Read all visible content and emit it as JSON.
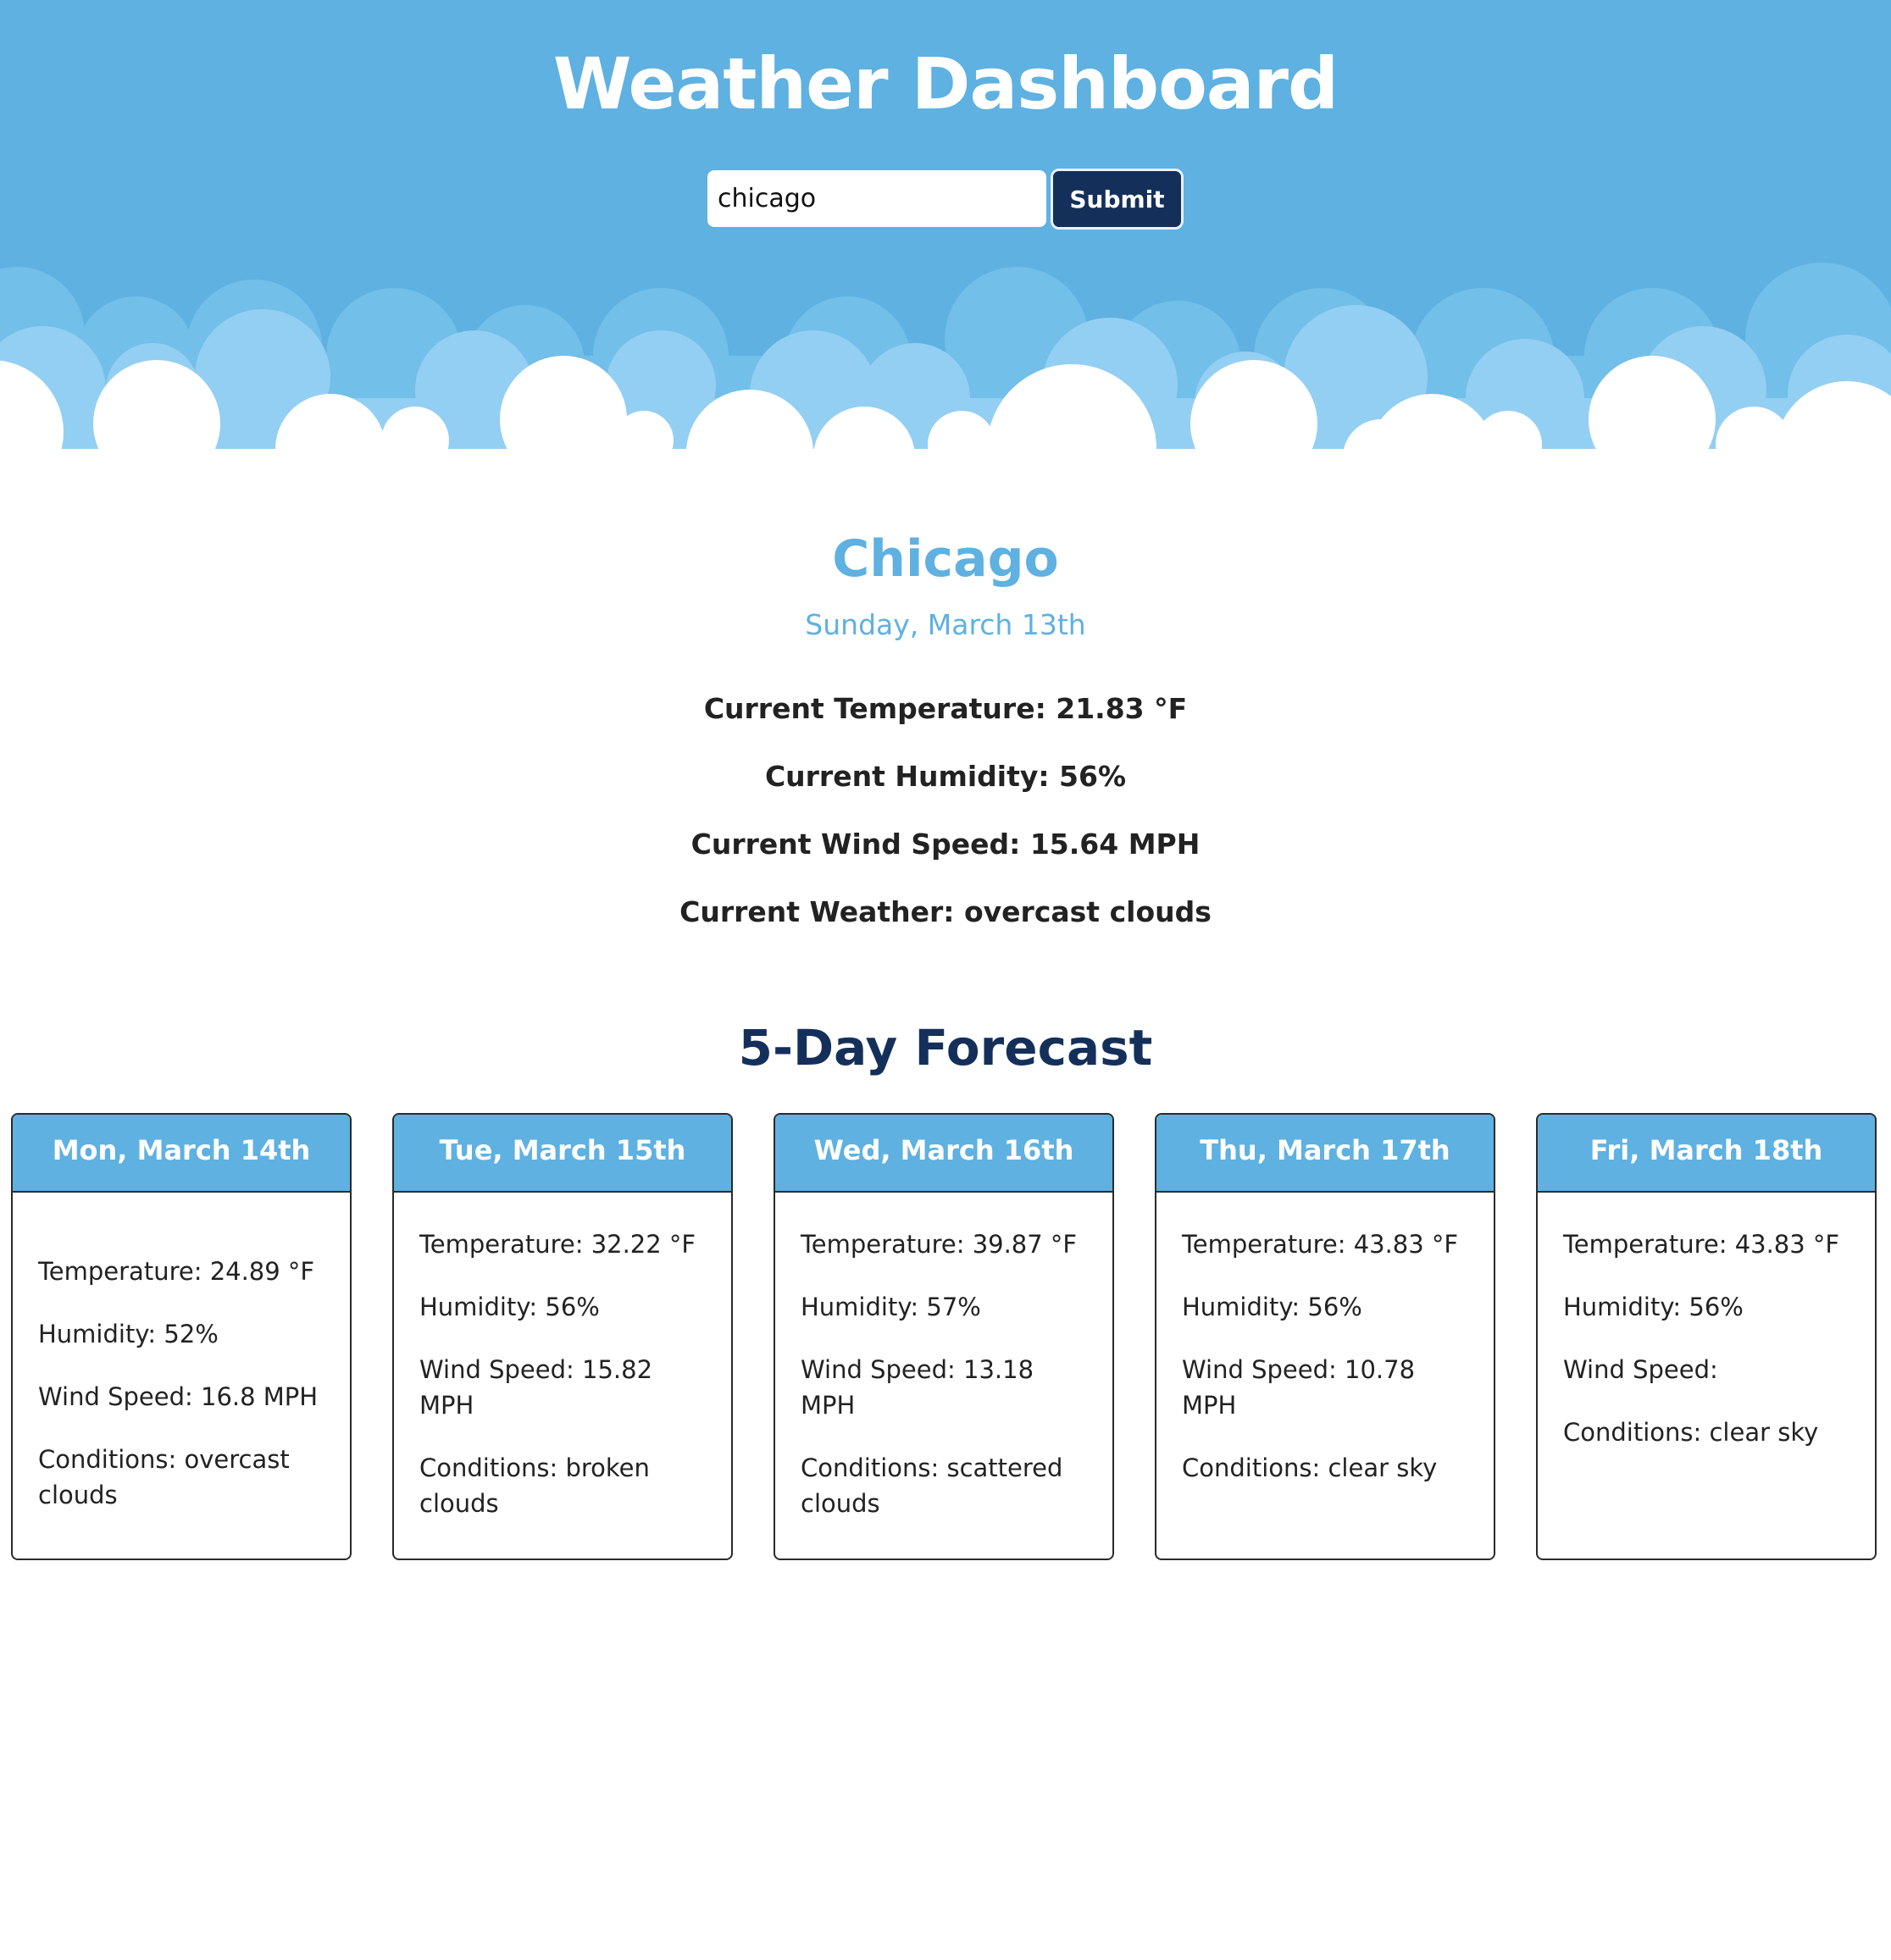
{
  "header": {
    "title": "Weather Dashboard",
    "search_value": "chicago",
    "submit_label": "Submit"
  },
  "current": {
    "city": "Chicago",
    "date": "Sunday, March 13th",
    "temperature": "Current Temperature: 21.83 °F",
    "humidity": "Current Humidity: 56%",
    "wind": "Current Wind Speed: 15.64 MPH",
    "weather": "Current Weather: overcast clouds"
  },
  "forecast": {
    "title": "5-Day Forecast",
    "days": [
      {
        "date": "Mon, March 14th",
        "temperature": "Temperature: 24.89 °F",
        "humidity": "Humidity: 52%",
        "wind": "Wind Speed: 16.8 MPH",
        "conditions": "Conditions: overcast clouds"
      },
      {
        "date": "Tue, March 15th",
        "temperature": "Temperature: 32.22 °F",
        "humidity": "Humidity: 56%",
        "wind": "Wind Speed: 15.82 MPH",
        "conditions": "Conditions: broken clouds"
      },
      {
        "date": "Wed, March 16th",
        "temperature": "Temperature: 39.87 °F",
        "humidity": "Humidity: 57%",
        "wind": "Wind Speed: 13.18 MPH",
        "conditions": "Conditions: scattered clouds"
      },
      {
        "date": "Thu, March 17th",
        "temperature": "Temperature: 43.83 °F",
        "humidity": "Humidity: 56%",
        "wind": "Wind Speed: 10.78 MPH",
        "conditions": "Conditions: clear sky"
      },
      {
        "date": "Fri, March 18th",
        "temperature": "Temperature: 43.83 °F",
        "humidity": "Humidity: 56%",
        "wind": "Wind Speed:",
        "conditions": "Conditions: clear sky"
      }
    ]
  },
  "colors": {
    "sky": "#5eb1e1",
    "cloud_back": "#72bfe9",
    "cloud_mid": "#93cff2",
    "button": "#14305a",
    "heading_dark": "#14305a"
  }
}
